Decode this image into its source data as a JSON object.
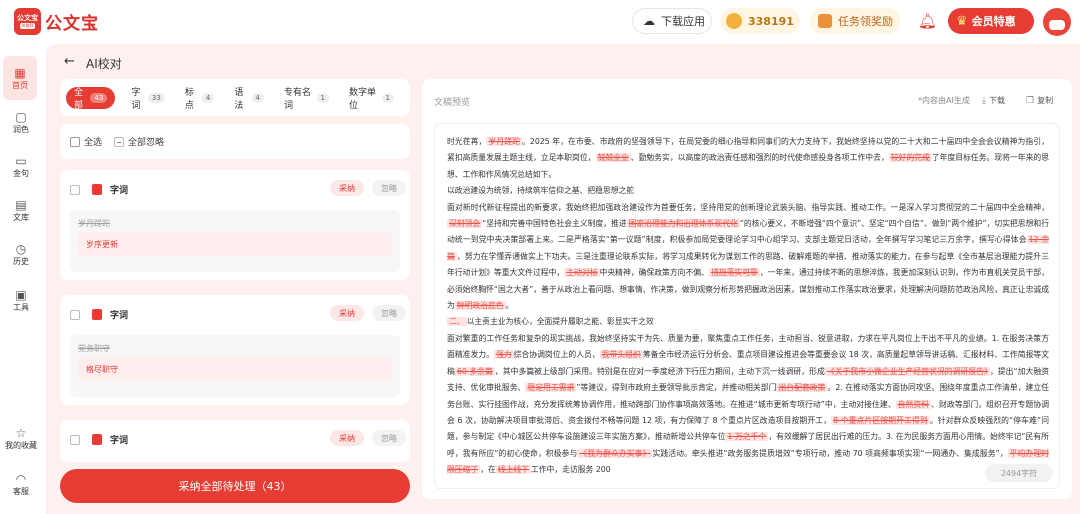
{
  "brand": {
    "logo_line1": "公文宝",
    "logo_line2": "AI推荐",
    "name": "公文宝"
  },
  "header": {
    "download_label": "下载应用",
    "coins": "338191",
    "task_label": "任务领奖励",
    "vip_label": "会员特惠"
  },
  "nav": [
    {
      "label": "首页",
      "icon": "home-icon"
    },
    {
      "label": "润色",
      "icon": "polish-icon"
    },
    {
      "label": "金句",
      "icon": "quote-icon"
    },
    {
      "label": "文库",
      "icon": "library-icon"
    },
    {
      "label": "历史",
      "icon": "history-icon"
    },
    {
      "label": "工具",
      "icon": "tools-icon"
    },
    {
      "label": "我的收藏",
      "icon": "star-icon"
    },
    {
      "label": "客服",
      "icon": "headset-icon"
    }
  ],
  "page_title": "AI校对",
  "tabs": [
    {
      "label": "全部",
      "count": "43"
    },
    {
      "label": "字词",
      "count": "33"
    },
    {
      "label": "标点",
      "count": "4"
    },
    {
      "label": "语法",
      "count": "4"
    },
    {
      "label": "专有名词",
      "count": "1"
    },
    {
      "label": "数字单位",
      "count": "1"
    }
  ],
  "select_all_label": "全选",
  "ignore_all_label": "全部忽略",
  "cards": [
    {
      "type": "字词",
      "accept": "采纳",
      "ignore": "忽略",
      "old": "岁月蹉跎",
      "new": "岁序更新"
    },
    {
      "type": "字词",
      "accept": "采纳",
      "ignore": "忽略",
      "old": "党务职守",
      "new": "格尽职守"
    },
    {
      "type": "字词",
      "accept": "采纳",
      "ignore": "忽略"
    }
  ],
  "accept_all_label": "采纳全部待处理（43）",
  "preview": {
    "label": "文稿预览",
    "ai_note": "*内容由AI生成",
    "download": "下载",
    "copy": "复制",
    "word_count": "2494字符",
    "p1_a": "时光荏苒，",
    "p1_hl1": "岁月蹉跎",
    "p1_b": "。2025 年，在市委、市政府的坚强领导下，在局党委的细心指导和同事们的大力支持下，我始终坚持以党的二十大和二十届四中全会会议精神为指引，紧扣高质量发展主题主线，立足本职岗位，",
    "p1_hl2": "兢兢业业",
    "p1_c": "、勤勉务实，以高度的政治责任感和强烈的时代使命感投身各项工作中去，",
    "p1_hl3": "较好的完成",
    "p1_d": "了年度目标任务。现将一年来的思想、工作和作风情况总结如下。",
    "p2": "以政治建设为统领，持续筑牢信仰之基、把稳思想之舵",
    "p3_a": "面对新时代新征程提出的新要求，我始终把加强政治建设作为首要任务，坚持用党的创新理论武装头脑、指导实践、推动工作。一是深入学习贯彻党的二十届四中全会精神，",
    "p3_hl1": "深刻领会",
    "p3_b": "“坚持和完善中国特色社会主义制度，推进",
    "p3_hl2": "国家治理能力和治理体系现代化",
    "p3_c": "”的核心要义，不断增强“四个意识”、坚定“四个自信”、做到“两个维护”，切实把思想和行动统一到党中央决策部署上来。二是严格落实“第一议题”制度，积极参加局党委理论学习中心组学习、支部主题党日活动，全年撰写学习笔记三万余字，撰写心得体会",
    "p3_hl3": "12 余篇",
    "p3_d": "，努力在学懂弄通做实上下功夫。三是注重理论联系实际，将学习成果转化为谋划工作的思路、破解难题的举措、推动落实的能力，在参与起草《全市基层治理能力提升三年行动计划》等重大文件过程中，",
    "p3_hl4": "主动对标",
    "p3_e": "中央精神，确保政策方向不偏、",
    "p3_hl5": "措施落实可靠",
    "p3_f": "，一年来，通过持续不断的思想淬炼，我更加深刻认识到，作为市直机关党员干部，必须始终胸怀“国之大者”，善于从政治上看问题、想事情、作决策，做到观察分析形势把握政治因素，谋划推动工作落实政治要求，处理解决问题防范政治风险，真正让忠诚成为",
    "p3_hl6": "鲜明政治底色",
    "p3_g": "。",
    "p4_hl": "二、",
    "p4": "以主责主业为核心，全面提升履职之能、彰显实干之效",
    "p5_a": "面对繁重的工作任务和复杂的现实挑战，我始终坚持实干为先、质量为要，聚焦重点工作任务，主动担当、锐意进取，力求在平凡岗位上干出不平凡的业绩。1. 在服务决策方面精准发力。",
    "p5_hl1": "强力",
    "p5_b": "综合协调岗位上的人员，",
    "p5_hl2": "我带头组织",
    "p5_c": "筹备全市经济运行分析会、重点项目建设推进会等重要会议 18 次，高质量起草领导讲话稿、汇报材料、工作简报等文稿",
    "p5_hl3": "60 多余篇",
    "p5_d": "，其中多篇被上级部门采用。特别是在应对一季度经济下行压力期间，主动下沉一线调研，形成",
    "p5_hl4": "《关于我市小微企业生产经营状况的调研报告》",
    "p5_e": "，提出“加大融资支持、优化审批服务、",
    "p5_hl5": "稳定用工需求",
    "p5_f": "”等建议，得到市政府主要领导批示肯定，并推动相关部门",
    "p5_hl6": "出台配套政策",
    "p5_g": "。2. 在推动落实方面协同攻坚。围绕年度重点工作清单，建立任务台账、实行挂图作战，充分发挥统筹协调作用，推动跨部门协作事项高效落地。在推进“城市更新专项行动”中，主动对接住建、",
    "p5_hl7": "自然资料",
    "p5_h": "、财政等部门，组织召开专题协调会 6 次，协助解决项目审批滞后、资金拨付不畅等问题 12 项，有力保障了 8 个重点片区改造项目按期开工，",
    "p5_hl8": "8 个重点片区按期开工得到",
    "p5_i": "。针对群众反映强烈的“停车难”问题，参与制定《中心城区公共停车设施建设三年实施方案》，推动新增公共停车位",
    "p5_hl9": "1 万之千个",
    "p5_j": "，有效缓解了居民出行难的压力。3. 在为民服务方面用心用情。始终牢记“民有所呼，我有所应”的初心使命，积极参与",
    "p5_hl10": "《我为群众办实事》",
    "p5_k": "实践活动。牵头推进“政务服务提质增效”专项行动，推动 70 项高频事项实现“一网通办、集成服务”，",
    "p5_hl11": "平均办理时限压缩了",
    "p5_l": "，在",
    "p5_hl12": "线上线下",
    "p5_m": "工作中，走访服务 200"
  }
}
